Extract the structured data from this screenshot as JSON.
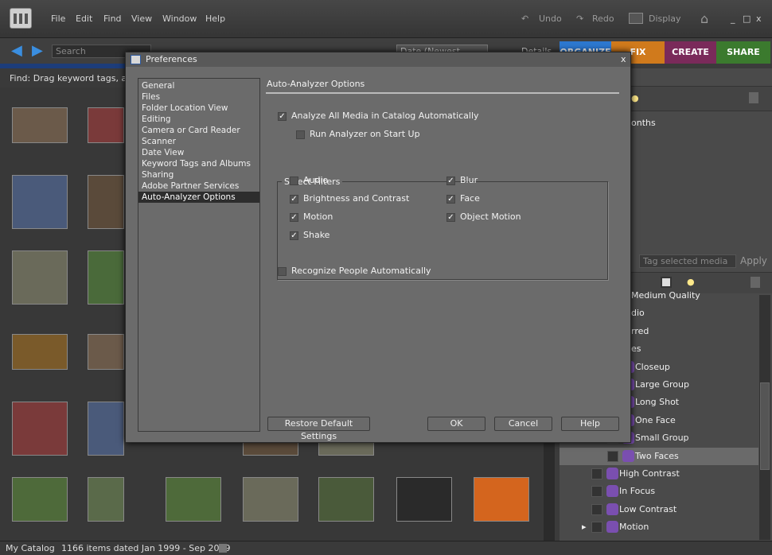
{
  "menubar": {
    "items": [
      "File",
      "Edit",
      "Find",
      "View",
      "Window",
      "Help"
    ],
    "undo": "Undo",
    "redo": "Redo",
    "display": "Display"
  },
  "toolbar": {
    "search_placeholder": "Search",
    "sort": "Date (Newest First)",
    "details": "Details"
  },
  "modes": [
    {
      "label": "ORGANIZE",
      "color": "#2d78d0"
    },
    {
      "label": "FIX",
      "color": "#d07a1c"
    },
    {
      "label": "CREATE",
      "color": "#7a2a5a"
    },
    {
      "label": "SHARE",
      "color": "#3b7a2e"
    }
  ],
  "find_bar": "Find: Drag keyword tags, albu",
  "right_panel": {
    "months_text": "onths",
    "tag_input_placeholder": "Tag selected media",
    "apply": "Apply",
    "tags": [
      "Medium Quality",
      "dio",
      "rred",
      "es",
      "Closeup",
      "Large Group",
      "Long Shot",
      "One Face",
      "Small Group",
      "Two Faces",
      "High Contrast",
      "In Focus",
      "Low Contrast",
      "Motion"
    ]
  },
  "status": {
    "catalog": "My Catalog",
    "items": "1166 items dated Jan 1999 - Sep 2009"
  },
  "dialog": {
    "title": "Preferences",
    "close": "x",
    "categories": [
      "General",
      "Files",
      "Folder Location View",
      "Editing",
      "Camera or Card Reader",
      "Scanner",
      "Date View",
      "Keyword Tags and Albums",
      "Sharing",
      "Adobe Partner Services",
      "Auto-Analyzer Options"
    ],
    "selected_category": "Auto-Analyzer Options",
    "section_title": "Auto-Analyzer Options",
    "analyze_all": {
      "label": "Analyze All Media in Catalog Automatically",
      "checked": true
    },
    "run_on_startup": {
      "label": "Run Analyzer on Start Up",
      "checked": false
    },
    "filters_title": "Select Filters",
    "filters": [
      {
        "label": "Audio",
        "checked": false
      },
      {
        "label": "Blur",
        "checked": true
      },
      {
        "label": "Brightness and Contrast",
        "checked": true
      },
      {
        "label": "Face",
        "checked": true
      },
      {
        "label": "Motion",
        "checked": true
      },
      {
        "label": "Object Motion",
        "checked": true
      },
      {
        "label": "Shake",
        "checked": true
      }
    ],
    "recognize_people": {
      "label": "Recognize People Automatically",
      "checked": false
    },
    "restore": "Restore Default Settings",
    "ok": "OK",
    "cancel": "Cancel",
    "help": "Help"
  }
}
